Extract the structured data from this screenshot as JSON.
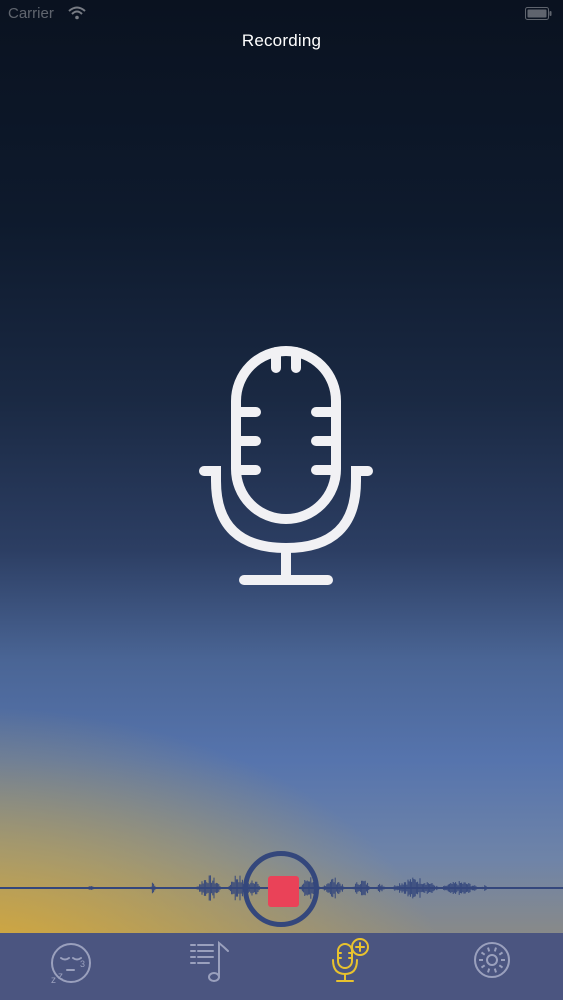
{
  "status_bar": {
    "carrier": "Carrier",
    "wifi_icon": "wifi-icon",
    "battery_icon": "battery-icon"
  },
  "header": {
    "title": "Recording"
  },
  "main": {
    "icon": "microphone-icon",
    "record_button": {
      "state": "recording",
      "icon": "stop-icon",
      "color": "#ea4258",
      "ring_color": "#34477c"
    }
  },
  "tab_bar": {
    "background": "#4b5580",
    "active_color": "#e8c22e",
    "tabs": [
      {
        "id": "sleep",
        "icon": "sleeping-face-icon",
        "active": false
      },
      {
        "id": "playlist",
        "icon": "music-list-icon",
        "active": false
      },
      {
        "id": "record",
        "icon": "add-microphone-icon",
        "active": true
      },
      {
        "id": "settings",
        "icon": "gear-icon",
        "active": false
      }
    ]
  },
  "colors": {
    "gradient_top": "#0a1220",
    "gradient_mid": "#5674ad",
    "gradient_glow": "#e8b028",
    "waveform": "#34477c"
  }
}
